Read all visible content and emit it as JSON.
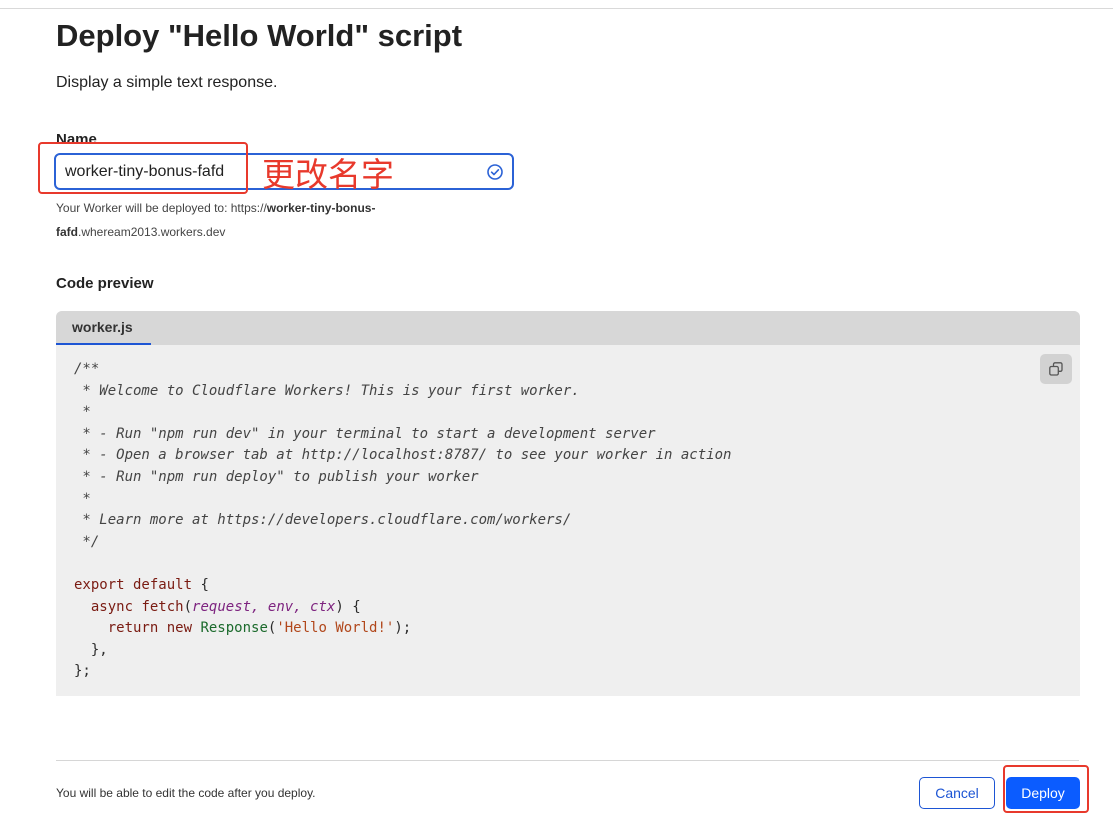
{
  "page": {
    "title": "Deploy \"Hello World\" script",
    "subtitle": "Display a simple text response."
  },
  "name_field": {
    "label": "Name",
    "value": "worker-tiny-bonus-fafd",
    "valid_icon": "check-circle-icon",
    "annotation": "更改名字"
  },
  "deploy_url": {
    "prefix": "Your Worker will be deployed to: https://",
    "bold": "worker-tiny-bonus-fafd",
    "suffix": ".whe­ream2013.workers.dev"
  },
  "code_preview": {
    "label": "Code preview",
    "tab": "worker.js",
    "copy_icon": "copy-icon",
    "lines": [
      [
        [
          "cm",
          "/**"
        ]
      ],
      [
        [
          "cm",
          " * Welcome to Cloudflare Workers! This is your first worker."
        ]
      ],
      [
        [
          "cm",
          " *"
        ]
      ],
      [
        [
          "cm",
          " * - Run \"npm run dev\" in your terminal to start a development server"
        ]
      ],
      [
        [
          "cm",
          " * - Open a browser tab at http://localhost:8787/ to see your worker in action"
        ]
      ],
      [
        [
          "cm",
          " * - Run \"npm run deploy\" to publish your worker"
        ]
      ],
      [
        [
          "cm",
          " *"
        ]
      ],
      [
        [
          "cm",
          " * Learn more at https://developers.cloudflare.com/workers/"
        ]
      ],
      [
        [
          "cm",
          " */"
        ]
      ],
      [
        [
          "pl",
          ""
        ]
      ],
      [
        [
          "kw",
          "export default"
        ],
        [
          "pl",
          " {"
        ]
      ],
      [
        [
          "pl",
          "  "
        ],
        [
          "kw",
          "async"
        ],
        [
          "pl",
          " "
        ],
        [
          "kw",
          "fetch"
        ],
        [
          "pl",
          "("
        ],
        [
          "param",
          "request, env, ctx"
        ],
        [
          "pl",
          ") {"
        ]
      ],
      [
        [
          "pl",
          "    "
        ],
        [
          "kw",
          "return new"
        ],
        [
          "pl",
          " "
        ],
        [
          "cls",
          "Response"
        ],
        [
          "pl",
          "("
        ],
        [
          "str",
          "'Hello World!'"
        ],
        [
          "pl",
          ");"
        ]
      ],
      [
        [
          "pl",
          "  },"
        ]
      ],
      [
        [
          "pl",
          "};"
        ]
      ]
    ]
  },
  "footer": {
    "note": "You will be able to edit the code after you deploy.",
    "cancel_label": "Cancel",
    "deploy_label": "Deploy"
  },
  "colors": {
    "accent": "#0b5cff",
    "annotation": "#e8392c"
  }
}
